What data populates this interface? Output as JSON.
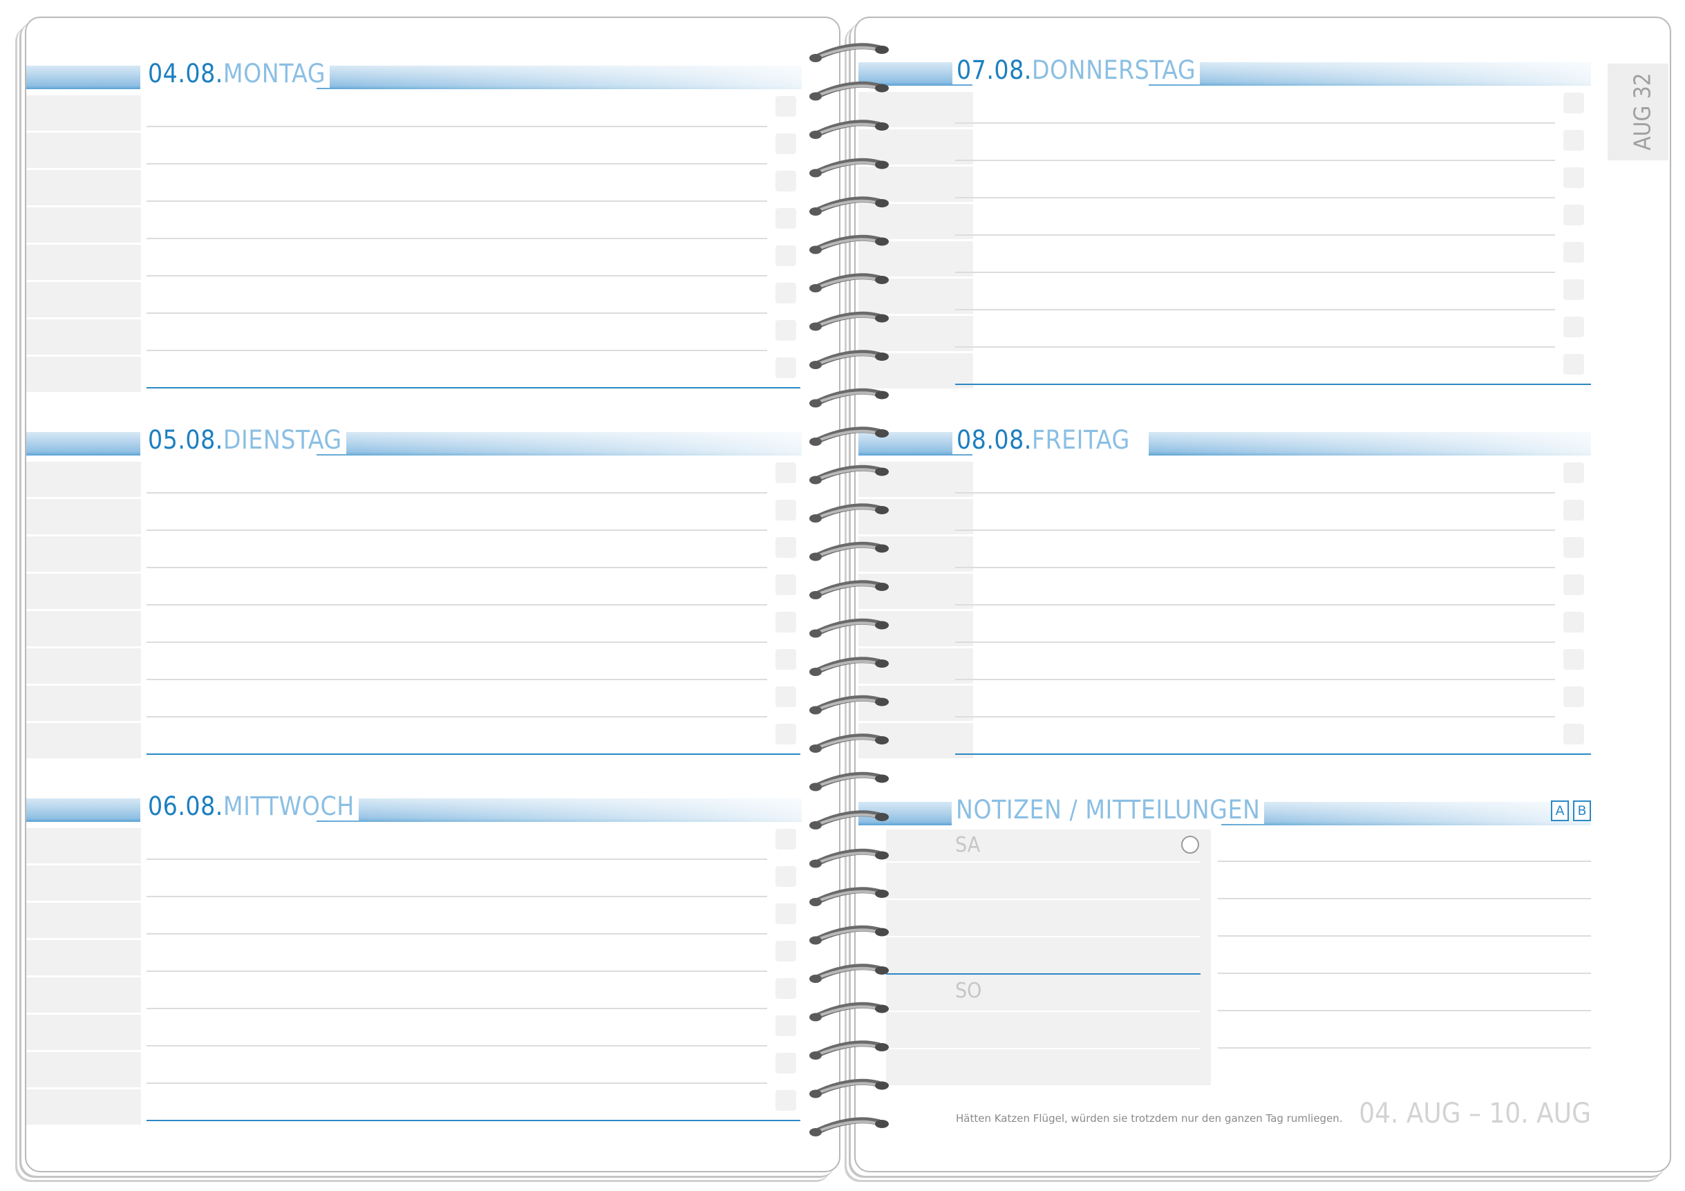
{
  "days": [
    {
      "date": "04.08.",
      "name": "MONTAG"
    },
    {
      "date": "05.08.",
      "name": "DIENSTAG"
    },
    {
      "date": "06.08.",
      "name": "MITTWOCH"
    },
    {
      "date": "07.08.",
      "name": "DONNERSTAG"
    },
    {
      "date": "08.08.",
      "name": "FREITAG"
    }
  ],
  "notes": {
    "title": "NOTIZEN / MITTEILUNGEN",
    "option_a": "A",
    "option_b": "B"
  },
  "weekend": {
    "saturday": "SA",
    "sunday": "SO"
  },
  "side_tab": "AUG 32",
  "quote": "Hätten Katzen Flügel, würden sie trotzdem nur den ganzen Tag rumliegen.",
  "week_range": "04. AUG – 10. AUG",
  "colors": {
    "accent": "#1c7fc0",
    "accent_light": "#8bbfe3",
    "line": "#2b88c4"
  }
}
